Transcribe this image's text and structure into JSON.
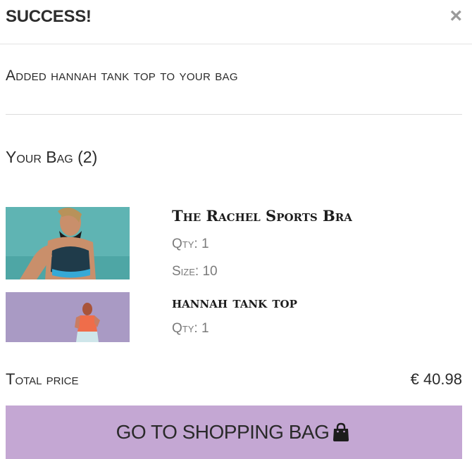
{
  "modal": {
    "title": "SUCCESS!",
    "close_label": "×",
    "message": "Added hannah tank top to your bag"
  },
  "bag": {
    "title": "Your Bag (2)",
    "items": [
      {
        "name": "The Rachel Sports Bra",
        "qty": "Qty: 1",
        "size": "Size: 10"
      },
      {
        "name": "hannah tank top",
        "qty": "Qty: 1"
      }
    ],
    "total_label": "Total price",
    "total_value": "€ 40.98"
  },
  "cta": {
    "label": "GO TO SHOPPING BAG",
    "icon": "shopping-bag-icon"
  },
  "colors": {
    "cta_background": "#c4a7d3",
    "item1_photo_bg": "#5fb4b3",
    "item2_photo_bg": "#a99ac4"
  }
}
